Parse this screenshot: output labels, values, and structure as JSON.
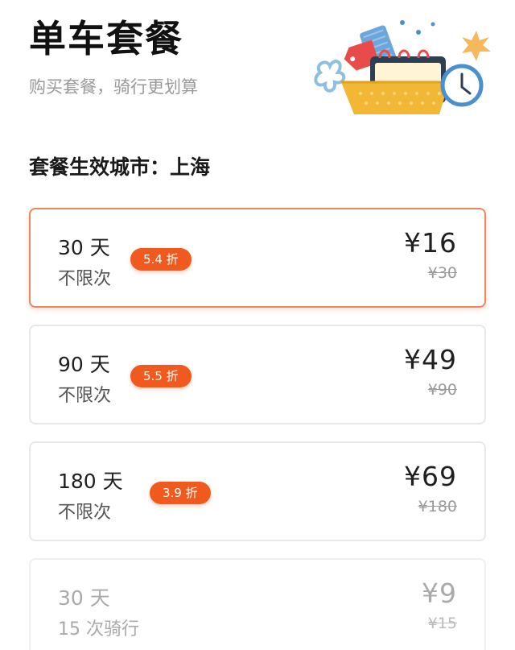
{
  "header": {
    "title": "单车套餐",
    "subtitle": "购买套餐，骑行更划算"
  },
  "city": {
    "label": "套餐生效城市：上海"
  },
  "plans": [
    {
      "duration": "30 天",
      "usage": "不限次",
      "discount": "5.4 折",
      "price": "¥16",
      "original_price": "¥30",
      "selected": true
    },
    {
      "duration": "90 天",
      "usage": "不限次",
      "discount": "5.5 折",
      "price": "¥49",
      "original_price": "¥90",
      "selected": false
    },
    {
      "duration": "180 天",
      "usage": "不限次",
      "discount": "3.9 折",
      "price": "¥69",
      "original_price": "¥180",
      "selected": false
    },
    {
      "duration": "30 天",
      "usage": "15 次骑行",
      "discount": "",
      "price": "¥9",
      "original_price": "¥15",
      "selected": false
    }
  ],
  "colors": {
    "accent": "#f05a1e",
    "selected_border": "#e58a5d"
  },
  "icons": {
    "header_illustration": "shopping-bag-ticket-clock-illustration"
  }
}
